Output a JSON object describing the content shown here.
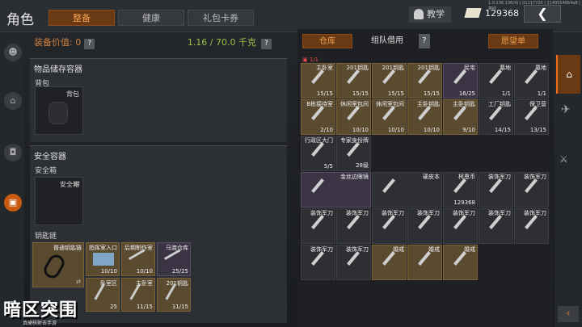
{
  "header": {
    "title": "角色",
    "tabs": [
      {
        "label": "整备",
        "active": true
      },
      {
        "label": "健康",
        "active": false
      },
      {
        "label": "礼包卡券",
        "active": false
      }
    ],
    "tutorial_label": "教学",
    "money": "129368",
    "status_text": "1.0.136.136(4) | 01117720 | 1140554664a8 | 离线"
  },
  "left_nav": {
    "items": [
      "person-icon",
      "backpack-icon",
      "vest-icon",
      "inventory-icon"
    ],
    "gift_label": "礼包"
  },
  "equipment": {
    "value_label": "装备价值: 0",
    "weight_label": "1.16 / 70.0 千克",
    "storage_title": "物品储存容器",
    "backpack_label": "背包",
    "backpack_slot": "背包",
    "safe_title": "安全容器",
    "safe_label": "安全箱",
    "safe_slot": "安全箱",
    "keychain_label": "钥匙链",
    "keychain_items": [
      {
        "name": "普通钥匙链",
        "qty": "",
        "color": "gold"
      },
      {
        "name": "指挥室入口",
        "qty": "10/10",
        "color": "gold"
      },
      {
        "name": "后期制作室",
        "qty": "10/10",
        "color": "gold"
      },
      {
        "name": "马渡仓库",
        "qty": "25/25",
        "color": "purple"
      },
      {
        "name": "",
        "qty": "25",
        "color": "gold"
      },
      {
        "name": "主卧室",
        "qty": "11/15",
        "color": "gold"
      },
      {
        "name": "201钥匙",
        "qty": "11/15",
        "color": "gold"
      },
      {
        "name": "卧室区",
        "qty": "",
        "color": "gold"
      }
    ]
  },
  "storage": {
    "tab_warehouse": "仓库",
    "tab_team": "组队借用",
    "wishlist": "愿望单",
    "page": "1/1",
    "rows": [
      [
        {
          "name": "主卧室",
          "qty": "15/15",
          "c": "gold"
        },
        {
          "name": "201钥匙",
          "qty": "15/15",
          "c": "gold"
        },
        {
          "name": "201钥匙",
          "qty": "15/15",
          "c": "gold"
        },
        {
          "name": "201钥匙",
          "qty": "15/15",
          "c": "gold"
        },
        {
          "name": "民宅",
          "qty": "16/25",
          "c": "purple"
        },
        {
          "name": "墓地",
          "qty": "1/1",
          "c": "dark"
        },
        {
          "name": "墓地",
          "qty": "1/1",
          "c": "dark"
        }
      ],
      [
        {
          "name": "B栋接待室",
          "qty": "2/10",
          "c": "gold"
        },
        {
          "name": "休闲室包间",
          "qty": "10/10",
          "c": "gold"
        },
        {
          "name": "休闲室包间",
          "qty": "10/10",
          "c": "gold"
        },
        {
          "name": "主卧钥匙",
          "qty": "10/10",
          "c": "gold"
        },
        {
          "name": "主卧钥匙",
          "qty": "9/10",
          "c": "gold"
        },
        {
          "name": "工厂钥匙",
          "qty": "14/15",
          "c": "dark"
        },
        {
          "name": "保卫营",
          "qty": "13/15",
          "c": "dark"
        }
      ],
      [
        {
          "name": "行政区大门",
          "qty": "5/5",
          "c": "dark"
        },
        {
          "name": "专家身份牌",
          "qty": "28级",
          "c": "dark"
        }
      ],
      [
        {
          "name": "金丝边眼镜",
          "qty": "",
          "c": "purple",
          "wide": true
        },
        {
          "name": "硬皮本",
          "qty": "",
          "c": "dark",
          "wide": true
        },
        {
          "name": "柯恩币",
          "qty": "129368",
          "c": "dark"
        },
        {
          "name": "装饰军刀",
          "qty": "",
          "c": "dark"
        },
        {
          "name": "装饰军刀",
          "qty": "",
          "c": "dark"
        }
      ],
      [
        {
          "name": "装饰军刀",
          "qty": "",
          "c": "dark"
        },
        {
          "name": "装饰军刀",
          "qty": "",
          "c": "dark"
        },
        {
          "name": "装饰军刀",
          "qty": "",
          "c": "dark"
        },
        {
          "name": "装饰军刀",
          "qty": "",
          "c": "dark"
        },
        {
          "name": "装饰军刀",
          "qty": "",
          "c": "dark"
        },
        {
          "name": "装饰军刀",
          "qty": "",
          "c": "dark"
        },
        {
          "name": "装饰军刀",
          "qty": "",
          "c": "dark"
        }
      ],
      [
        {
          "name": "装饰军刀",
          "qty": "",
          "c": "dark"
        },
        {
          "name": "装饰军刀",
          "qty": "",
          "c": "dark"
        },
        {
          "name": "婚戒",
          "qty": "",
          "c": "gold"
        },
        {
          "name": "婚戒",
          "qty": "",
          "c": "gold"
        },
        {
          "name": "婚戒",
          "qty": "",
          "c": "gold"
        }
      ]
    ]
  },
  "logo": {
    "title": "暗区突围",
    "subtitle": "真硬核射击手游"
  }
}
